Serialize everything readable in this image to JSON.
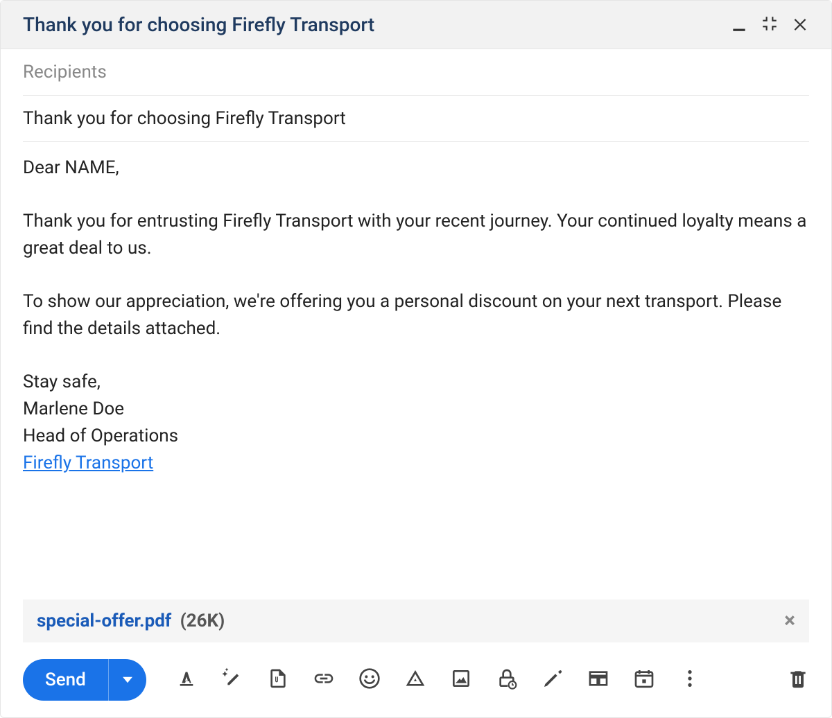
{
  "header": {
    "title": "Thank you for choosing Firefly Transport"
  },
  "fields": {
    "recipients_placeholder": "Recipients",
    "subject": "Thank you for choosing Firefly Transport"
  },
  "body": {
    "greeting": "Dear NAME,",
    "p1": "Thank you for entrusting Firefly Transport with your recent journey. Your continued loyalty means a great deal to us.",
    "p2": "To show our appreciation, we're offering you a personal discount on your next transport. Please find the details attached.",
    "closing": "Stay safe,",
    "signature_name": "Marlene Doe",
    "signature_title": "Head of Operations",
    "signature_link_text": "Firefly Transport"
  },
  "attachment": {
    "name": "special-offer.pdf",
    "size": "(26K)"
  },
  "toolbar": {
    "send_label": "Send"
  }
}
